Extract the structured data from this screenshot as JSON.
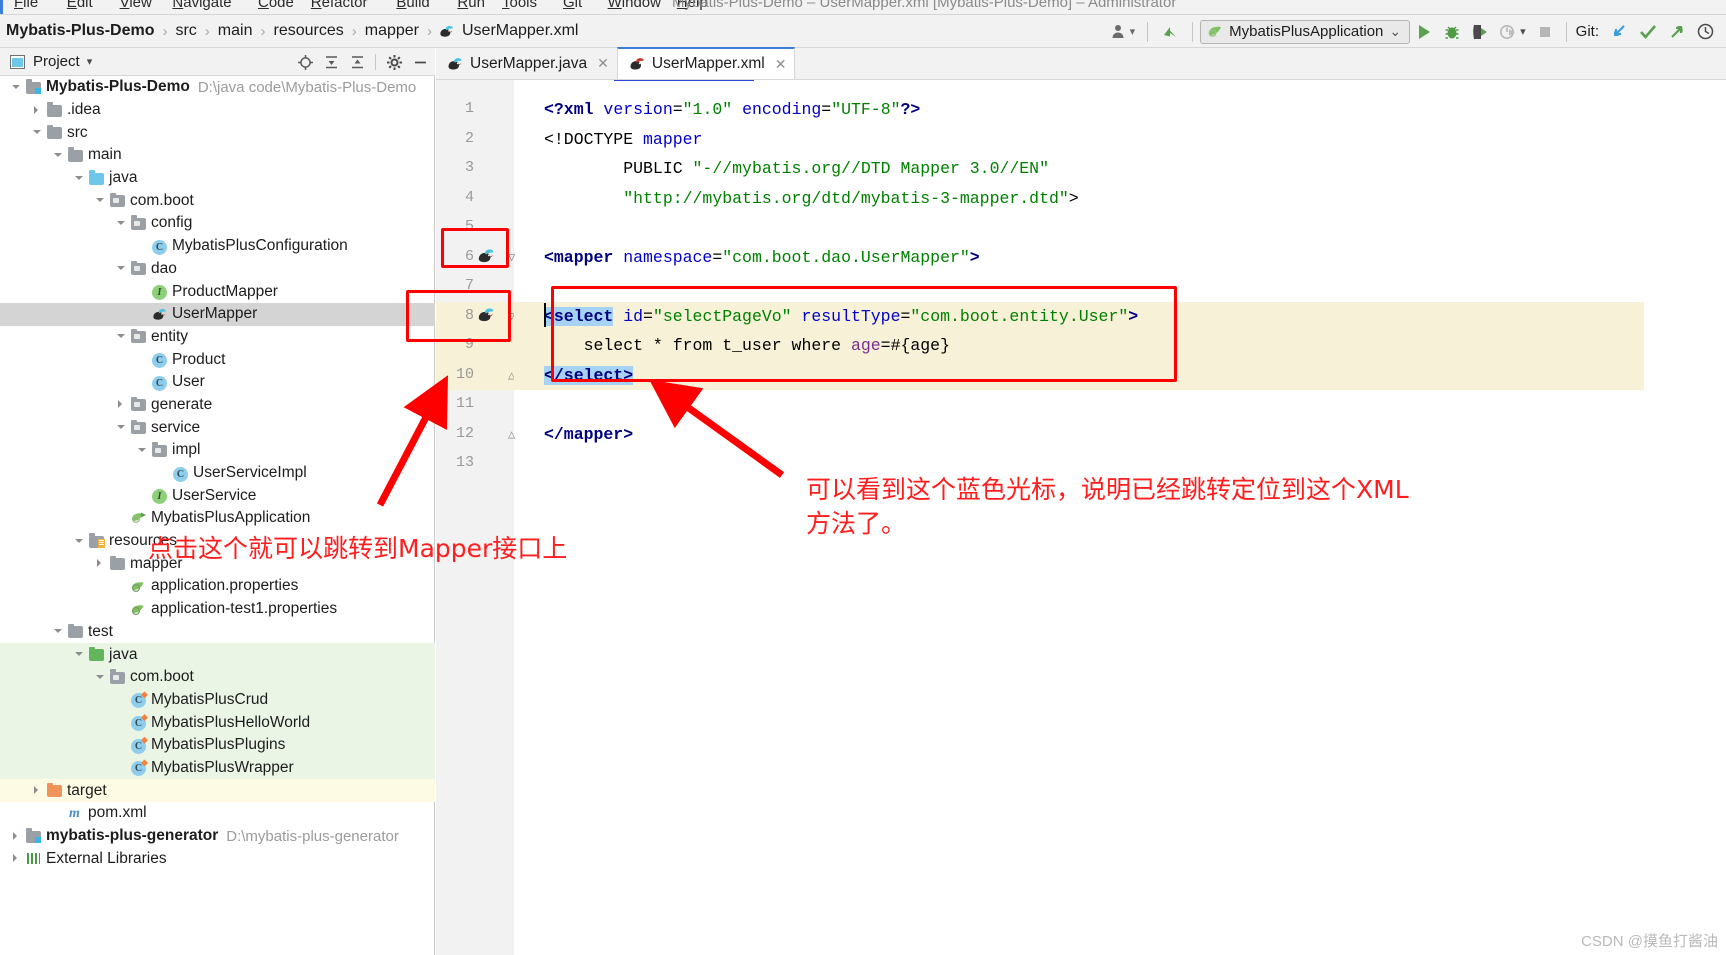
{
  "window": {
    "title": "Mybatis-Plus-Demo – UserMapper.xml [Mybatis-Plus-Demo] – Administrator",
    "menu": [
      "File",
      "Edit",
      "View",
      "Navigate",
      "Code",
      "Refactor",
      "Build",
      "Run",
      "Tools",
      "Git",
      "Window",
      "Help"
    ]
  },
  "breadcrumb": {
    "items": [
      "Mybatis-Plus-Demo",
      "src",
      "main",
      "resources",
      "mapper",
      "UserMapper.xml"
    ],
    "separator": "›",
    "file_icon": "mybatis-mapper-icon"
  },
  "toolbar": {
    "user_icon": "user-avatar-icon",
    "user_caret": "▾",
    "update_icon": "update-project-icon",
    "run_config": {
      "icon": "spring-boot-icon",
      "label": "MybatisPlusApplication",
      "caret": "⌄"
    },
    "run_icon": "run-play-icon",
    "debug_icon": "debug-bug-icon",
    "run_coverage_icon": "run-with-coverage-icon",
    "profiler_icon": "profiler-icon",
    "profiler_caret": "▾",
    "stop_icon": "stop-square-icon",
    "git_label": "Git:",
    "git_update_icon": "git-pull-icon",
    "git_commit_icon": "git-commit-check-icon",
    "git_push_icon": "git-push-icon",
    "git_history_icon": "git-history-clock-icon",
    "accent_blue": "#3b7dd8",
    "accent_green": "#59a14f"
  },
  "project_panel": {
    "title": "Project",
    "title_caret": "▾",
    "window_icon": "project-window-icon",
    "actions": [
      {
        "name": "locate-icon",
        "glyph": "⊕"
      },
      {
        "name": "expand-all-icon",
        "glyph": "≡"
      },
      {
        "name": "collapse-all-icon",
        "glyph": "≡"
      },
      {
        "name": "settings-gear-icon",
        "glyph": "⚙"
      },
      {
        "name": "hide-window-icon",
        "glyph": "—"
      }
    ]
  },
  "tree": [
    {
      "label": "Mybatis-Plus-Demo",
      "path": "D:\\java code\\Mybatis-Plus-Demo",
      "indent": 0,
      "arrow": "down",
      "icon": "module-folder-icon",
      "bold": true,
      "bg": "none"
    },
    {
      "label": ".idea",
      "path": "",
      "indent": 1,
      "arrow": "right",
      "icon": "folder-grey-icon",
      "bold": false,
      "bg": "none"
    },
    {
      "label": "src",
      "path": "",
      "indent": 1,
      "arrow": "down",
      "icon": "folder-grey-icon",
      "bold": false,
      "bg": "none"
    },
    {
      "label": "main",
      "path": "",
      "indent": 2,
      "arrow": "down",
      "icon": "folder-grey-icon",
      "bold": false,
      "bg": "none"
    },
    {
      "label": "java",
      "path": "",
      "indent": 3,
      "arrow": "down",
      "icon": "folder-source-blue-icon",
      "bold": false,
      "bg": "none"
    },
    {
      "label": "com.boot",
      "path": "",
      "indent": 4,
      "arrow": "down",
      "icon": "package-icon",
      "bold": false,
      "bg": "none"
    },
    {
      "label": "config",
      "path": "",
      "indent": 5,
      "arrow": "down",
      "icon": "package-icon",
      "bold": false,
      "bg": "none"
    },
    {
      "label": "MybatisPlusConfiguration",
      "path": "",
      "indent": 6,
      "arrow": "none",
      "icon": "java-class-icon",
      "bold": false,
      "bg": "none"
    },
    {
      "label": "dao",
      "path": "",
      "indent": 5,
      "arrow": "down",
      "icon": "package-icon",
      "bold": false,
      "bg": "none"
    },
    {
      "label": "ProductMapper",
      "path": "",
      "indent": 6,
      "arrow": "none",
      "icon": "java-interface-icon",
      "bold": false,
      "bg": "none"
    },
    {
      "label": "UserMapper",
      "path": "",
      "indent": 6,
      "arrow": "none",
      "icon": "mybatis-mapper-icon",
      "bold": false,
      "bg": "selected"
    },
    {
      "label": "entity",
      "path": "",
      "indent": 5,
      "arrow": "down",
      "icon": "package-icon",
      "bold": false,
      "bg": "none"
    },
    {
      "label": "Product",
      "path": "",
      "indent": 6,
      "arrow": "none",
      "icon": "java-class-icon",
      "bold": false,
      "bg": "none"
    },
    {
      "label": "User",
      "path": "",
      "indent": 6,
      "arrow": "none",
      "icon": "java-class-icon",
      "bold": false,
      "bg": "none"
    },
    {
      "label": "generate",
      "path": "",
      "indent": 5,
      "arrow": "right",
      "icon": "package-icon",
      "bold": false,
      "bg": "none"
    },
    {
      "label": "service",
      "path": "",
      "indent": 5,
      "arrow": "down",
      "icon": "package-icon",
      "bold": false,
      "bg": "none"
    },
    {
      "label": "impl",
      "path": "",
      "indent": 6,
      "arrow": "down",
      "icon": "package-icon",
      "bold": false,
      "bg": "none"
    },
    {
      "label": "UserServiceImpl",
      "path": "",
      "indent": 7,
      "arrow": "none",
      "icon": "java-class-icon",
      "bold": false,
      "bg": "none"
    },
    {
      "label": "UserService",
      "path": "",
      "indent": 6,
      "arrow": "none",
      "icon": "java-interface-icon",
      "bold": false,
      "bg": "none"
    },
    {
      "label": "MybatisPlusApplication",
      "path": "",
      "indent": 5,
      "arrow": "none",
      "icon": "spring-boot-class-icon",
      "bold": false,
      "bg": "none"
    },
    {
      "label": "resources",
      "path": "",
      "indent": 3,
      "arrow": "down",
      "icon": "folder-resources-icon",
      "bold": false,
      "bg": "none"
    },
    {
      "label": "mapper",
      "path": "",
      "indent": 4,
      "arrow": "right",
      "icon": "folder-grey-icon",
      "bold": false,
      "bg": "none"
    },
    {
      "label": "application.properties",
      "path": "",
      "indent": 5,
      "arrow": "none",
      "icon": "spring-properties-icon",
      "bold": false,
      "bg": "none"
    },
    {
      "label": "application-test1.properties",
      "path": "",
      "indent": 5,
      "arrow": "none",
      "icon": "spring-properties-icon",
      "bold": false,
      "bg": "none"
    },
    {
      "label": "test",
      "path": "",
      "indent": 2,
      "arrow": "down",
      "icon": "folder-grey-icon",
      "bold": false,
      "bg": "none"
    },
    {
      "label": "java",
      "path": "",
      "indent": 3,
      "arrow": "down",
      "icon": "folder-test-green-icon",
      "bold": false,
      "bg": "test"
    },
    {
      "label": "com.boot",
      "path": "",
      "indent": 4,
      "arrow": "down",
      "icon": "package-icon",
      "bold": false,
      "bg": "test"
    },
    {
      "label": "MybatisPlusCrud",
      "path": "",
      "indent": 5,
      "arrow": "none",
      "icon": "java-test-class-icon",
      "bold": false,
      "bg": "test"
    },
    {
      "label": "MybatisPlusHelloWorld",
      "path": "",
      "indent": 5,
      "arrow": "none",
      "icon": "java-test-class-icon",
      "bold": false,
      "bg": "test"
    },
    {
      "label": "MybatisPlusPlugins",
      "path": "",
      "indent": 5,
      "arrow": "none",
      "icon": "java-test-class-icon",
      "bold": false,
      "bg": "test"
    },
    {
      "label": "MybatisPlusWrapper",
      "path": "",
      "indent": 5,
      "arrow": "none",
      "icon": "java-test-class-icon",
      "bold": false,
      "bg": "test"
    },
    {
      "label": "target",
      "path": "",
      "indent": 1,
      "arrow": "right",
      "icon": "folder-excluded-orange-icon",
      "bold": false,
      "bg": "excluded"
    },
    {
      "label": "pom.xml",
      "path": "",
      "indent": 2,
      "arrow": "none",
      "icon": "maven-pom-icon",
      "bold": false,
      "bg": "none"
    },
    {
      "label": "mybatis-plus-generator",
      "path": "D:\\mybatis-plus-generator",
      "indent": 0,
      "arrow": "right",
      "icon": "module-folder-icon",
      "bold": true,
      "bg": "none"
    },
    {
      "label": "External Libraries",
      "path": "",
      "indent": 0,
      "arrow": "right",
      "icon": "external-libraries-icon",
      "bold": false,
      "bg": "none"
    }
  ],
  "editor": {
    "tabs": [
      {
        "label": "UserMapper.java",
        "icon": "mybatis-mapper-icon",
        "active": false,
        "closable": true
      },
      {
        "label": "UserMapper.xml",
        "icon": "mybatis-xml-icon",
        "active": true,
        "closable": true
      }
    ],
    "line_numbers": [
      "1",
      "2",
      "3",
      "4",
      "5",
      "6",
      "7",
      "8",
      "9",
      "10",
      "11",
      "12",
      "13"
    ],
    "gutter_icons": [
      {
        "line": 6,
        "name": "mybatis-navigate-icon"
      },
      {
        "line": 8,
        "name": "mybatis-navigate-icon"
      }
    ],
    "lines": [
      {
        "n": 1,
        "text": "<?xml version=\"1.0\" encoding=\"UTF-8\"?>"
      },
      {
        "n": 2,
        "text": "<!DOCTYPE mapper"
      },
      {
        "n": 3,
        "text": "        PUBLIC \"-//mybatis.org//DTD Mapper 3.0//EN\""
      },
      {
        "n": 4,
        "text": "        \"http://mybatis.org/dtd/mybatis-3-mapper.dtd\">"
      },
      {
        "n": 5,
        "text": ""
      },
      {
        "n": 6,
        "text": "<mapper namespace=\"com.boot.dao.UserMapper\">"
      },
      {
        "n": 7,
        "text": ""
      },
      {
        "n": 8,
        "text": "<select id=\"selectPageVo\" resultType=\"com.boot.entity.User\">"
      },
      {
        "n": 9,
        "text": "    select * from t_user where age=#{age}"
      },
      {
        "n": 10,
        "text": "</select>"
      },
      {
        "n": 11,
        "text": ""
      },
      {
        "n": 12,
        "text": "</mapper>"
      },
      {
        "n": 13,
        "text": ""
      }
    ]
  },
  "annotations": {
    "note_tree": "点击这个就可以跳转到Mapper接口上",
    "note_editor_line1": "可以看到这个蓝色光标，说明已经跳转定位到这个XML",
    "note_editor_line2": "方法了。",
    "color": "#ff1d1d"
  },
  "watermark": "CSDN @摸鱼打酱油"
}
